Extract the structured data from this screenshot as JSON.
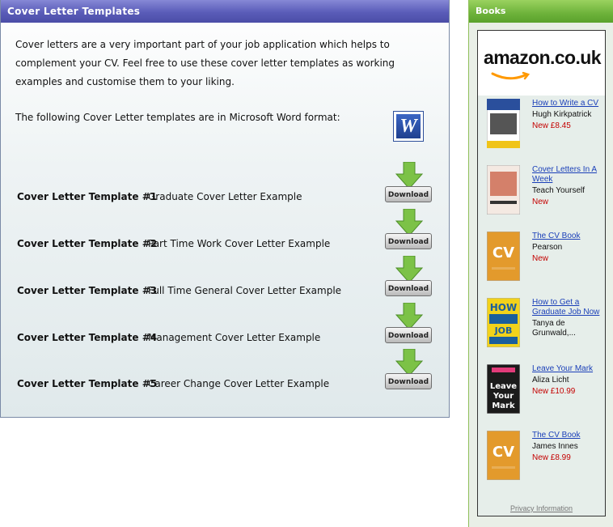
{
  "panel": {
    "title": "Cover Letter Templates",
    "intro": "Cover letters are a very important part of your job application which helps to complement your CV. Feel free to use these cover letter templates as working examples and customise them to your liking.",
    "format_line": "The following Cover Letter templates are in Microsoft Word format:",
    "word_icon_letter": "W",
    "download_label": "Download",
    "templates": [
      {
        "name": "Cover Letter Template #1",
        "desc": "Graduate Cover Letter Example"
      },
      {
        "name": "Cover Letter Template #2",
        "desc": "Part Time Work Cover Letter Example"
      },
      {
        "name": "Cover Letter Template #3",
        "desc": "Full Time General Cover Letter Example"
      },
      {
        "name": "Cover Letter Template #4",
        "desc": "Management Cover Letter Example"
      },
      {
        "name": "Cover Letter Template #5",
        "desc": "Career Change Cover Letter Example"
      }
    ]
  },
  "sidebar": {
    "title": "Books",
    "amazon_logo": "amazon.co.uk",
    "books": [
      {
        "title": "How to Write a CV",
        "author": "Hugh Kirkpatrick",
        "price": "New £8.45",
        "cover_text": "How to Write a CV",
        "cover_color": "#2a4f9c"
      },
      {
        "title": "Cover Letters In A Week",
        "author": "Teach Yourself",
        "price": "New",
        "cover_text": "COVER LETTERS",
        "cover_color": "#d4806a"
      },
      {
        "title": "The CV Book",
        "author": "Pearson",
        "price": "New",
        "cover_text": "CV",
        "cover_color": "#e39a2c"
      },
      {
        "title": "How to Get a Graduate Job Now",
        "author": "Tanya de Grunwald,...",
        "price": "",
        "cover_text": "HOW JOB NOW",
        "cover_color": "#f2d21a"
      },
      {
        "title": "Leave Your Mark",
        "author": "Aliza Licht",
        "price": "New £10.99",
        "cover_text": "Leave Your Mark",
        "cover_color": "#1b1b1b"
      },
      {
        "title": "The CV Book",
        "author": "James Innes",
        "price": "New £8.99",
        "cover_text": "CV",
        "cover_color": "#e39a2c"
      }
    ],
    "privacy": "Privacy Information"
  },
  "colors": {
    "panel_header": "#5a5cb8",
    "sidebar_header": "#6db23a",
    "link": "#1a3fb8",
    "price": "#c40000",
    "download_arrow": "#7cc247"
  }
}
